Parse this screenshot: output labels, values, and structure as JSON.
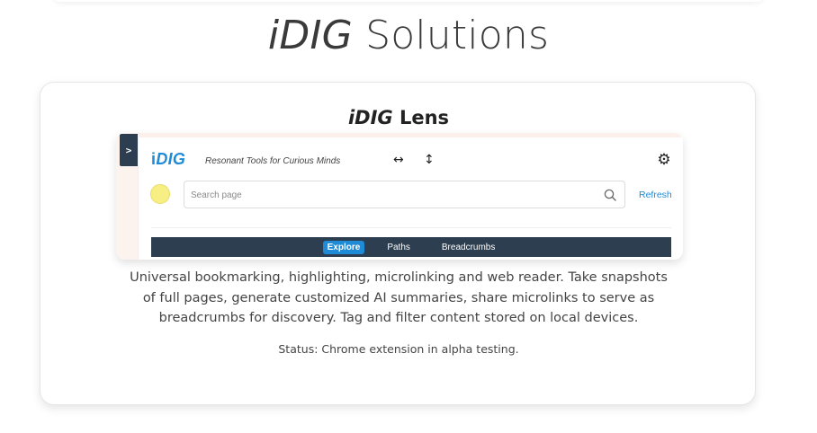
{
  "page": {
    "title_prefix": "i",
    "title_brand": "DIG",
    "title_suffix": " Solutions"
  },
  "card": {
    "title_prefix": "i",
    "title_brand": "DIG",
    "title_suffix": " Lens",
    "description": "Universal bookmarking, highlighting, microlinking and web reader. Take snapshots of full pages, generate customized AI summaries, share microlinks to serve as breadcrumbs for discovery. Tag and filter content stored on local devices.",
    "status": "Status: Chrome extension in alpha testing."
  },
  "screenshot": {
    "toggle_label": ">",
    "brand_prefix": "i",
    "brand_main": "DIG",
    "tagline": "Resonant Tools for Curious Minds",
    "resize_horizontal": "↔",
    "resize_vertical": "↕",
    "gear_glyph": "⚙",
    "search_placeholder": "Search page",
    "refresh_label": "Refresh",
    "nav": [
      {
        "label": "Explore",
        "active": true
      },
      {
        "label": "Paths",
        "active": false
      },
      {
        "label": "Breadcrumbs",
        "active": false
      }
    ],
    "colors": {
      "accent": "#1f8ad6",
      "navbar": "#2c3e50",
      "highlight_dot": "#f7ee84"
    },
    "icons": [
      "toggle-icon",
      "resize-horizontal-icon",
      "resize-vertical-icon",
      "gear-icon",
      "highlight-color-icon",
      "search-icon"
    ]
  }
}
